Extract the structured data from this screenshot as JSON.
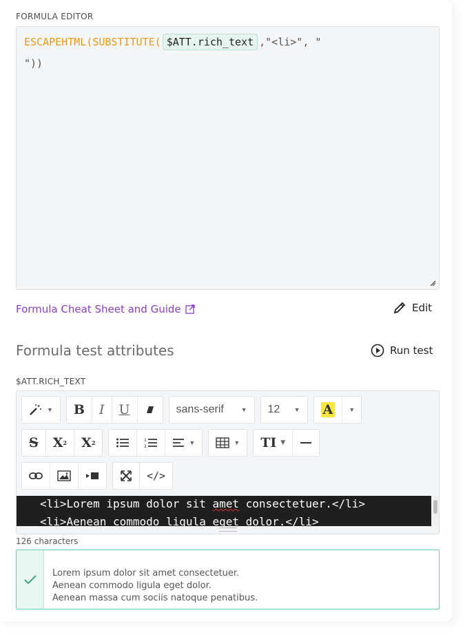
{
  "formula_editor": {
    "label": "FORMULA EDITOR",
    "fn1": "ESCAPEHTML(",
    "fn2": "SUBSTITUTE(",
    "token": "$ATT.rich_text",
    "args": ",\"<li>\", \"",
    "line2": "\"))"
  },
  "links": {
    "cheat_sheet": "Formula Cheat Sheet and Guide",
    "edit": "Edit"
  },
  "test": {
    "title": "Formula test attributes",
    "run": "Run test",
    "attribute_label": "$ATT.RICH_TEXT"
  },
  "toolbar": {
    "font_family": "sans-serif",
    "font_size": "12",
    "color_letter": "A",
    "bold": "B",
    "italic": "I",
    "underline": "U",
    "superscript": "X",
    "subscript": "X",
    "code_view": "</>",
    "text_style": "TI"
  },
  "code": {
    "line1_pre": "<li>Lorem ipsum dolor sit ",
    "line1_mis": "amet",
    "line1_post": " consectetuer.</li>",
    "line2": "<li>Aenean commodo ligula eget dolor.</li>"
  },
  "char_count": "126 characters",
  "result": {
    "lines": [
      "Lorem ipsum dolor sit amet consectetuer.",
      "Aenean commodo ligula eget dolor.",
      "Aenean massa cum sociis natoque penatibus."
    ]
  },
  "colors": {
    "accent": "#8a3fbf",
    "function": "#e69a1d",
    "success": "#3aa57d",
    "highlight": "#f5e642"
  }
}
